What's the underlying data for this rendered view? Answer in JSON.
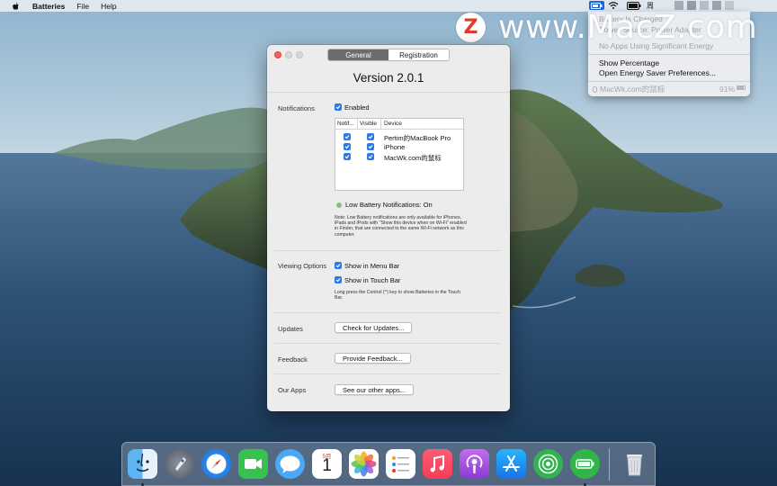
{
  "menubar": {
    "app_name": "Batteries",
    "menus": [
      "File",
      "Help"
    ],
    "status_glyph": "周"
  },
  "status_menu": {
    "rows_dim": [
      "Battery Is Charged",
      "Power Source: Power Adapter",
      "No Apps Using Significant Energy"
    ],
    "items": [
      "Show Percentage",
      "Open Energy Saver Preferences..."
    ],
    "device_name": "MacWk.com的鼠标",
    "device_percent": "91%"
  },
  "watermark": {
    "logo_letter": "Z",
    "text": "www.MacZ.com"
  },
  "window": {
    "tabs": [
      {
        "label": "General",
        "active": true
      },
      {
        "label": "Registration",
        "active": false
      }
    ],
    "version": "Version 2.0.1",
    "notifications": {
      "section_label": "Notifications",
      "enabled_label": "Enabled",
      "table_headers": [
        "Notif...",
        "Visible",
        "Device"
      ],
      "devices": [
        {
          "name": "Pertim的MacBook Pro",
          "notify": true,
          "visible": true
        },
        {
          "name": "iPhone",
          "notify": true,
          "visible": true
        },
        {
          "name": "MacWk.com的鼠标",
          "notify": true,
          "visible": true
        }
      ],
      "low_battery_label": "Low Battery Notifications: On",
      "note": "Note: Low Battery notifications are only available for iPhones, iPads and iPods with \"Show this device when on Wi-Fi\" enabled in Finder, that are connected to the same Wi-Fi network as this computer."
    },
    "viewing": {
      "section_label": "Viewing Options",
      "menu_bar_label": "Show in Menu Bar",
      "touch_bar_label": "Show in Touch Bar",
      "note": "Long press the Control (^) key to show Batteries in the Touch Bar."
    },
    "updates": {
      "section_label": "Updates",
      "button": "Check for Updates..."
    },
    "feedback": {
      "section_label": "Feedback",
      "button": "Provide Feedback..."
    },
    "apps": {
      "section_label": "Our Apps",
      "button": "See our other apps..."
    }
  },
  "dock": {
    "calendar_month": "5月",
    "calendar_day": "1",
    "apps": [
      "finder-icon",
      "launchpad-icon",
      "safari-icon",
      "facetime-icon",
      "messages-icon",
      "calendar-icon",
      "photos-icon",
      "reminders-icon",
      "music-icon",
      "podcasts-icon",
      "app-store-icon",
      "find-my-icon",
      "batteries-icon",
      "trash-icon"
    ]
  }
}
